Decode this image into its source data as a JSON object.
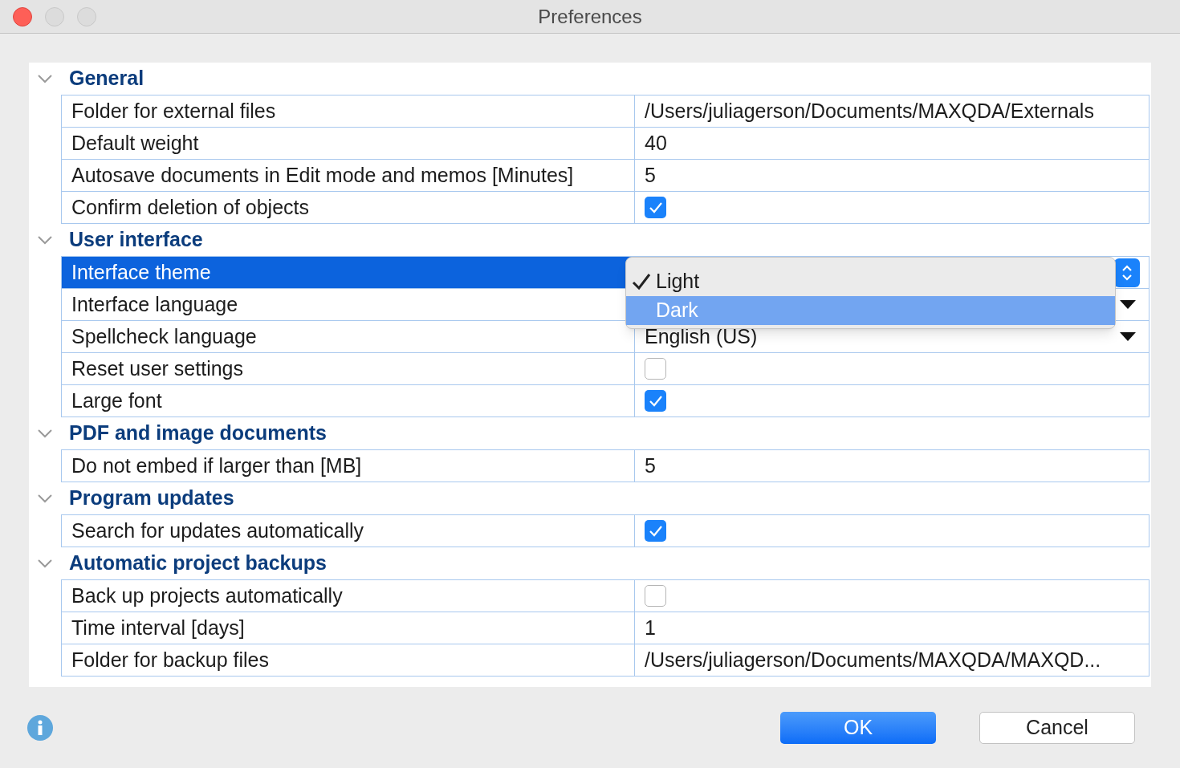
{
  "window": {
    "title": "Preferences"
  },
  "sections": [
    {
      "title": "General",
      "expanded": true,
      "rows": [
        {
          "label": "Folder for external files",
          "kind": "text",
          "value": "/Users/juliagerson/Documents/MAXQDA/Externals",
          "selected": false
        },
        {
          "label": "Default weight",
          "kind": "text",
          "value": "40",
          "selected": false
        },
        {
          "label": "Autosave documents in Edit mode and memos [Minutes]",
          "kind": "text",
          "value": "5",
          "selected": false
        },
        {
          "label": "Confirm deletion of objects",
          "kind": "checkbox",
          "checked": true,
          "selected": false
        }
      ]
    },
    {
      "title": "User interface",
      "expanded": true,
      "rows": [
        {
          "label": "Interface theme",
          "kind": "popup",
          "selected": true
        },
        {
          "label": "Interface language",
          "kind": "select",
          "selected": false
        },
        {
          "label": "Spellcheck language",
          "kind": "select",
          "value": "English (US)",
          "selected": false
        },
        {
          "label": "Reset user settings",
          "kind": "checkbox",
          "checked": false,
          "selected": false
        },
        {
          "label": "Large font",
          "kind": "checkbox",
          "checked": true,
          "selected": false
        }
      ]
    },
    {
      "title": "PDF and image documents",
      "expanded": true,
      "rows": [
        {
          "label": "Do not embed if larger than [MB]",
          "kind": "text",
          "value": "5",
          "selected": false
        }
      ]
    },
    {
      "title": "Program updates",
      "expanded": true,
      "rows": [
        {
          "label": "Search for updates automatically",
          "kind": "checkbox",
          "checked": true,
          "selected": false
        }
      ]
    },
    {
      "title": "Automatic project backups",
      "expanded": true,
      "rows": [
        {
          "label": "Back up projects automatically",
          "kind": "checkbox",
          "checked": false,
          "selected": false
        },
        {
          "label": "Time interval [days]",
          "kind": "text",
          "value": "1",
          "selected": false
        },
        {
          "label": "Folder for backup files",
          "kind": "text",
          "value": "/Users/juliagerson/Documents/MAXQDA/MAXQD...",
          "selected": false
        }
      ]
    }
  ],
  "popup": {
    "options": [
      {
        "label": "Light",
        "checked": true,
        "selected": false
      },
      {
        "label": "Dark",
        "checked": false,
        "selected": true
      }
    ]
  },
  "buttons": [
    {
      "label": "OK",
      "kind": "primary"
    },
    {
      "label": "Cancel",
      "kind": "secondary"
    }
  ]
}
